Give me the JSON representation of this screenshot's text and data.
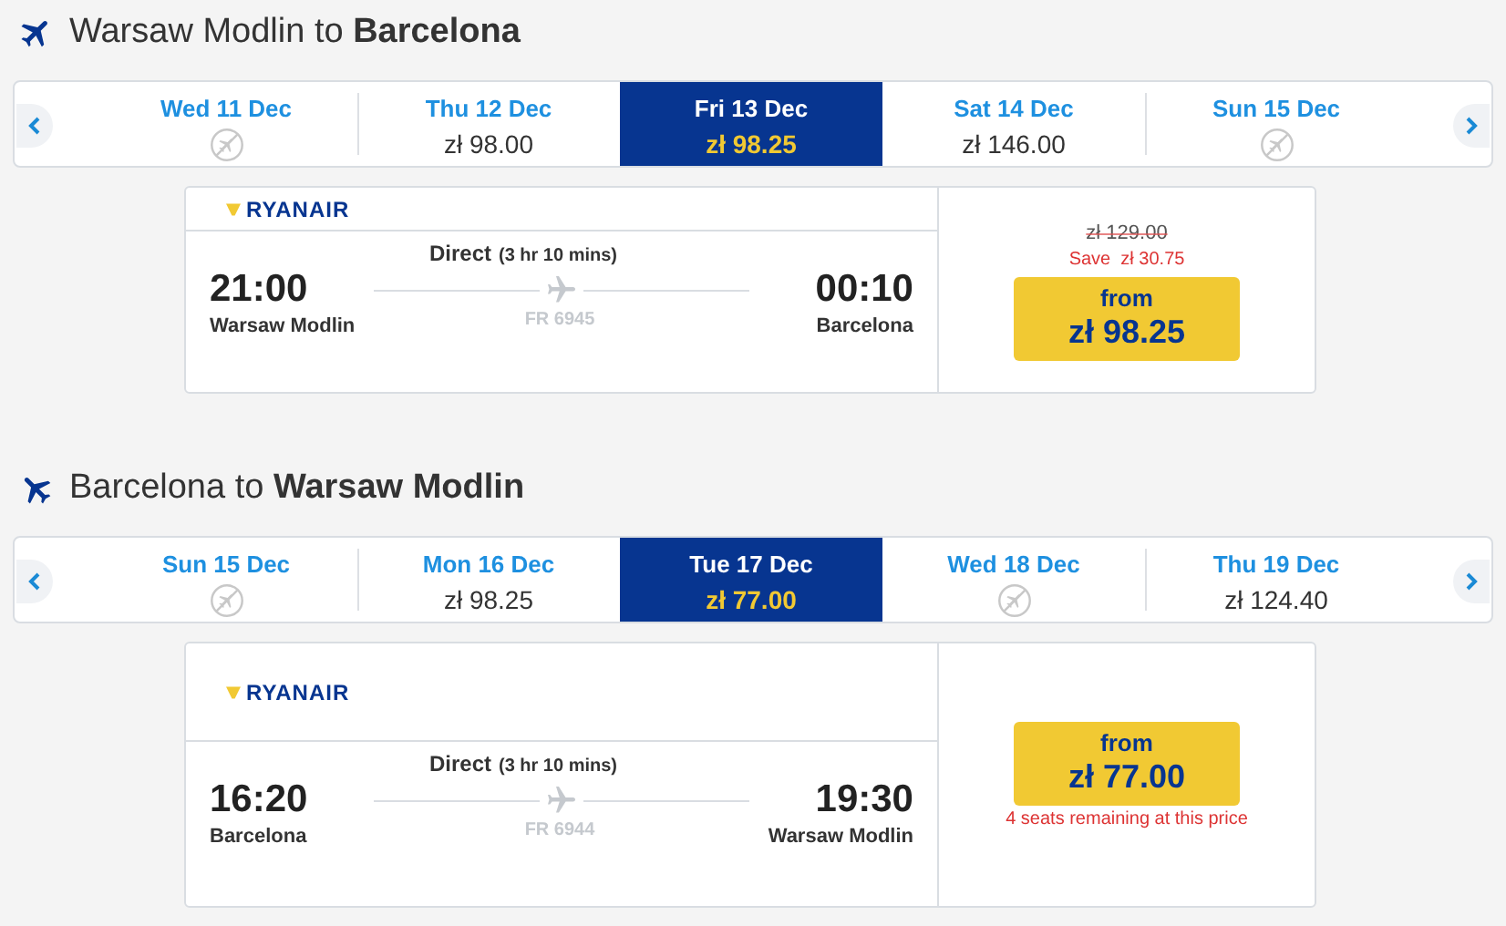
{
  "journeys": [
    {
      "title": "Warsaw Modlin to **Barcelona**",
      "dates": [
        {
          "label": "Wed 11 Dec",
          "kind": "no-flight",
          "selected": false
        },
        {
          "label": "Thu 12 Dec",
          "kind": "price",
          "price": "zł 98.00",
          "selected": false
        },
        {
          "label": "Fri 13 Dec",
          "kind": "price",
          "price": "zł 98.25",
          "selected": true
        },
        {
          "label": "Sat 14 Dec",
          "kind": "price",
          "price": "zł 146.00",
          "selected": false
        },
        {
          "label": "Sun 15 Dec",
          "kind": "no-flight",
          "selected": false
        }
      ],
      "flight": {
        "airline": "RYANAIR",
        "direct": "Direct",
        "duration": "(3 hr 10 mins)",
        "depart_time": "21:00",
        "depart_city": "Warsaw Modlin",
        "arrive_time": "00:10",
        "arrive_city": "Barcelona",
        "flight_number": "FR 6945",
        "fare": {
          "original_price": "zł 129.00",
          "saving": "Save  zł 30.75",
          "from": "from",
          "price": "zł 98.25"
        }
      }
    },
    {
      "title": "Barcelona to **Warsaw Modlin**",
      "dates": [
        {
          "label": "Sun 15 Dec",
          "kind": "no-flight",
          "selected": false
        },
        {
          "label": "Mon 16 Dec",
          "kind": "price",
          "price": "zł 98.25",
          "selected": false
        },
        {
          "label": "Tue 17 Dec",
          "kind": "price",
          "price": "zł 77.00",
          "selected": true
        },
        {
          "label": "Wed 18 Dec",
          "kind": "no-flight",
          "selected": false
        },
        {
          "label": "Thu 19 Dec",
          "kind": "price",
          "price": "zł 124.40",
          "selected": false
        }
      ],
      "flight": {
        "airline": "RYANAIR",
        "direct": "Direct",
        "duration": "(3 hr 10 mins)",
        "depart_time": "16:20",
        "depart_city": "Barcelona",
        "arrive_time": "19:30",
        "arrive_city": "Warsaw Modlin",
        "flight_number": "FR 6944",
        "fare": {
          "from": "from",
          "price": "zł 77.00",
          "note": "4 seats remaining at this price"
        }
      }
    }
  ]
}
